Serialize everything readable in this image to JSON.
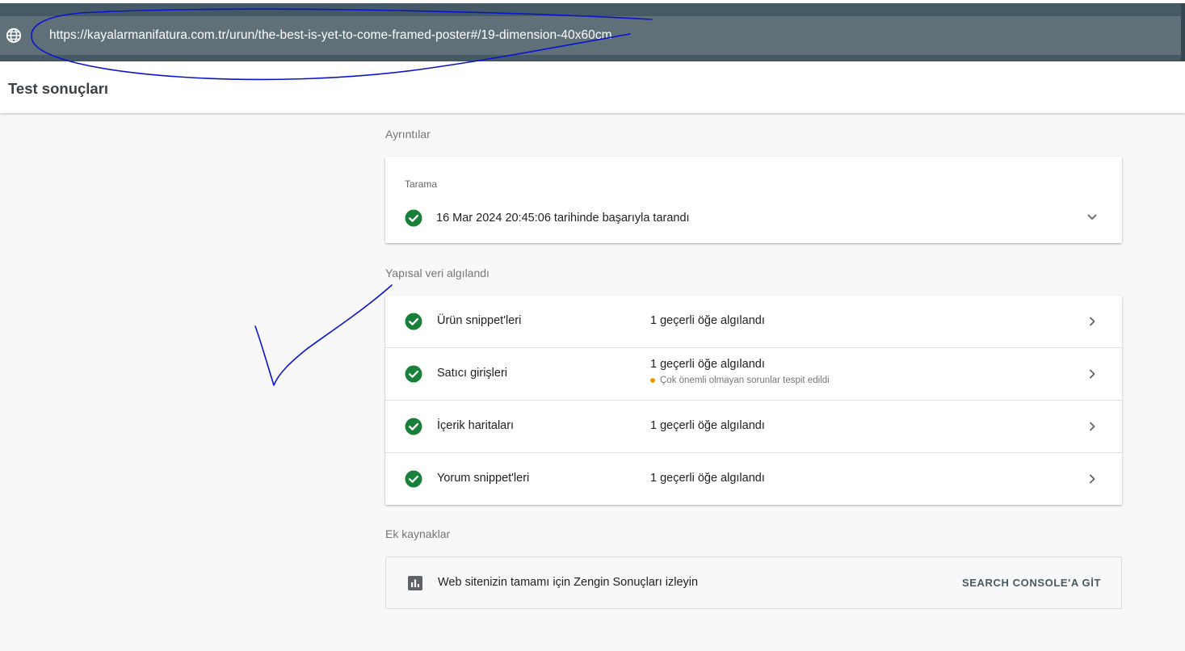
{
  "browser": {
    "url": "https://kayalarmanifatura.com.tr/urun/the-best-is-yet-to-come-framed-poster#/19-dimension-40x60cm",
    "globe_icon": "globe-icon"
  },
  "header": {
    "title": "Test sonuçları"
  },
  "details": {
    "section_label": "Ayrıntılar",
    "crawl": {
      "label": "Tarama",
      "status_text": "16 Mar 2024 20:45:06 tarihinde başarıyla tarandı",
      "status_icon": "check-circle-icon",
      "expand_icon": "chevron-down-icon"
    }
  },
  "structured_data": {
    "section_label": "Yapısal veri algılandı",
    "items": [
      {
        "name": "Ürün snippet'leri",
        "status": "1 geçerli öğe algılandı",
        "warning": ""
      },
      {
        "name": "Satıcı girişleri",
        "status": "1 geçerli öğe algılandı",
        "warning": "Çok önemli olmayan sorunlar tespit edildi"
      },
      {
        "name": "İçerik haritaları",
        "status": "1 geçerli öğe algılandı",
        "warning": ""
      },
      {
        "name": "Yorum snippet'leri",
        "status": "1 geçerli öğe algılandı",
        "warning": ""
      }
    ],
    "status_icon": "check-circle-icon",
    "row_icon": "chevron-right-icon"
  },
  "resources": {
    "section_label": "Ek kaynaklar",
    "item_text": "Web sitenizin tamamı için Zengin Sonuçları izleyin",
    "item_icon": "bar-chart-icon",
    "link_label": "SEARCH CONSOLE'A GİT"
  },
  "colors": {
    "topbar": "#455a64",
    "urlbar": "#5f7079",
    "success_green": "#188038",
    "warning_orange": "#f29900",
    "link_text": "#455a64",
    "annotation_ink": "#0a14d0"
  }
}
